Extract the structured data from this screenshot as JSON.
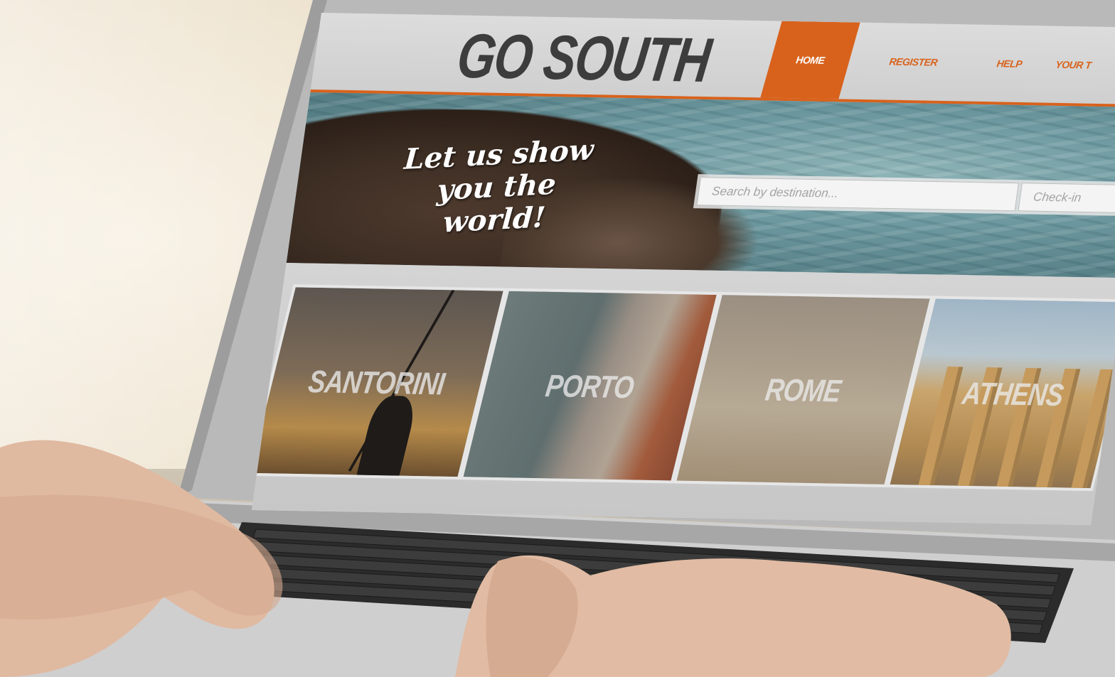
{
  "site": {
    "logo": "GO SOUTH",
    "nav": [
      {
        "label": "HOME",
        "active": true
      },
      {
        "label": "REGISTER",
        "active": false
      },
      {
        "label": "HELP",
        "active": false
      },
      {
        "label": "YOUR T",
        "active": false
      }
    ],
    "tagline": "Let us show you the world!",
    "search": {
      "destination_placeholder": "Search by destination...",
      "checkin_placeholder": "Check-in"
    },
    "destinations": [
      {
        "label": "SANTORINI"
      },
      {
        "label": "PORTO"
      },
      {
        "label": "ROME"
      },
      {
        "label": "ATHENS"
      }
    ]
  },
  "colors": {
    "accent": "#d8621c",
    "header_bg": "#d6d6d6",
    "logo_text": "#3d3d3d"
  }
}
